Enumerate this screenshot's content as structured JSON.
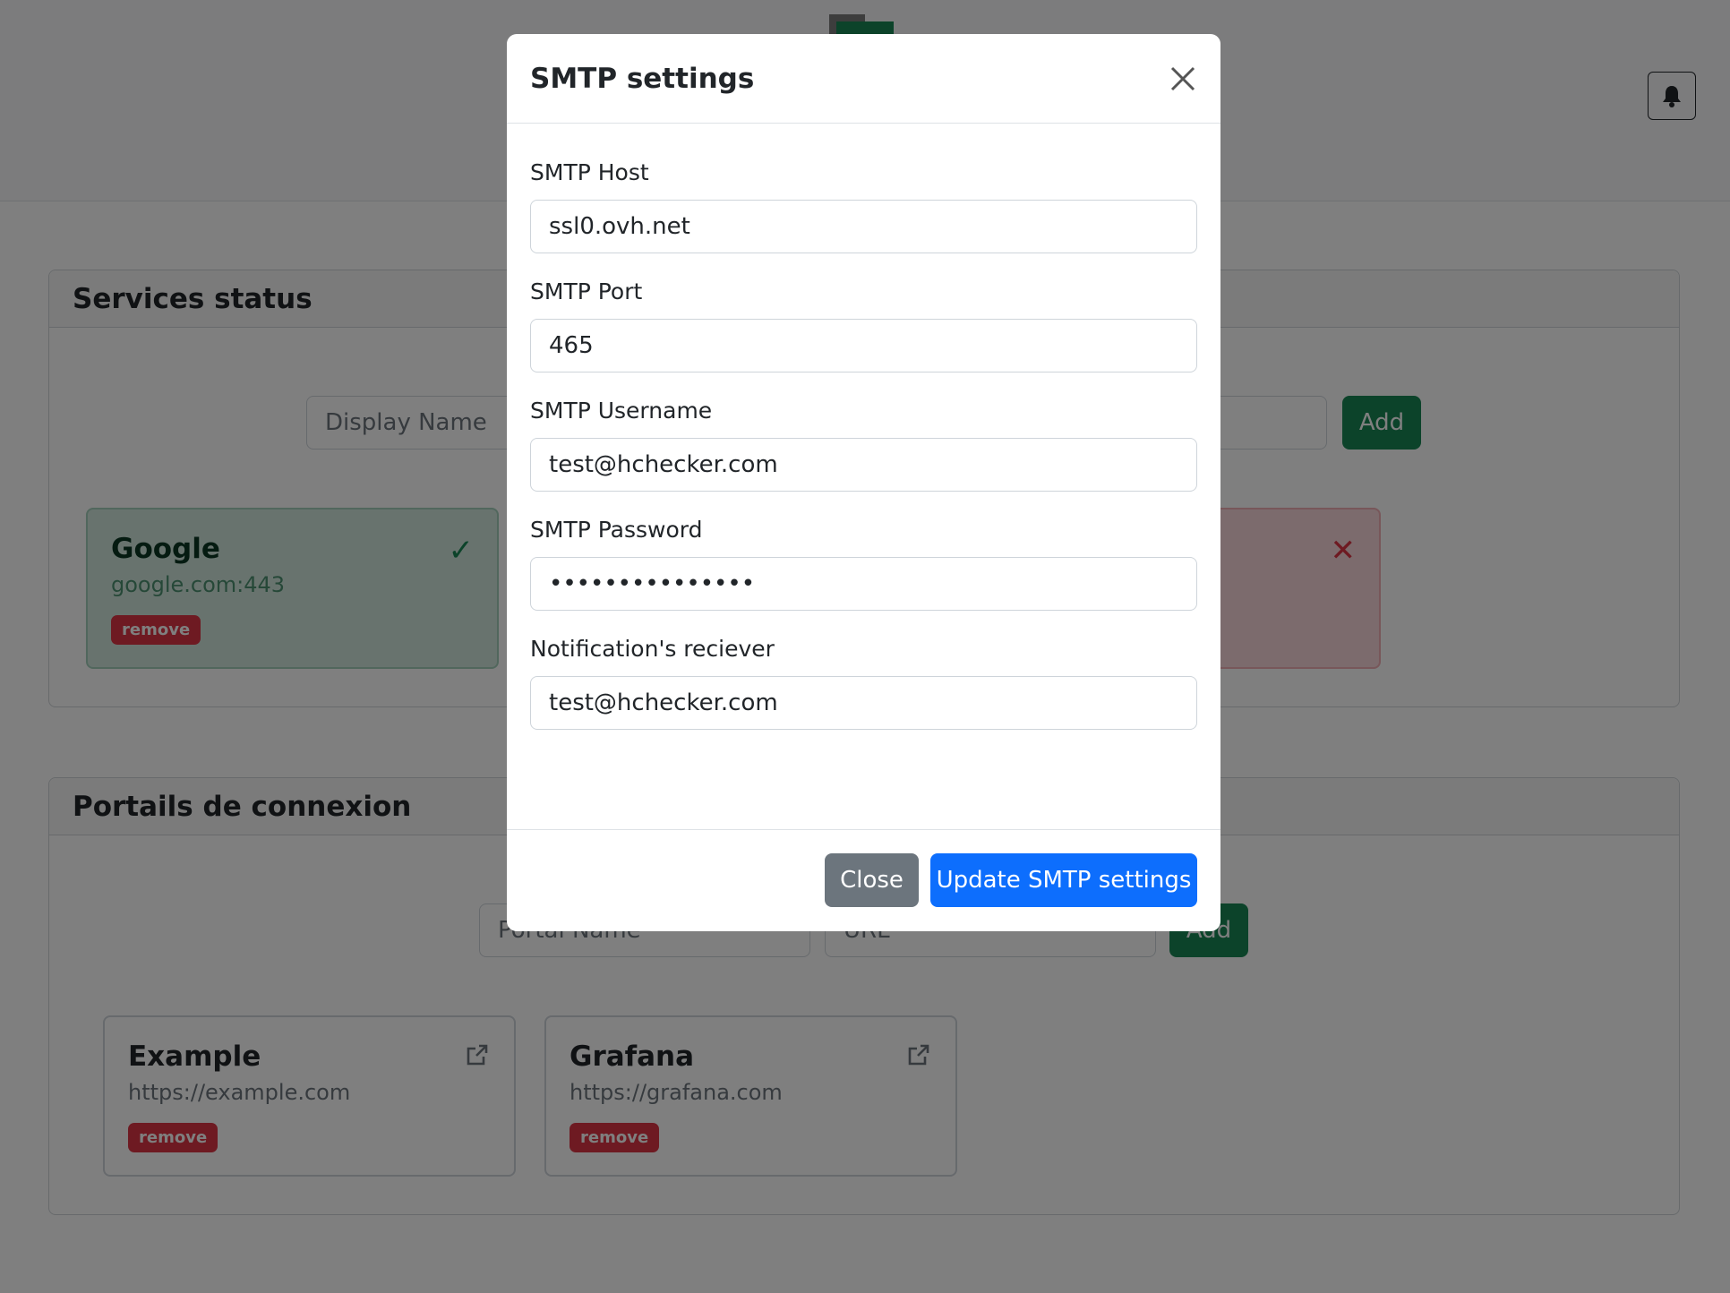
{
  "services": {
    "title": "Services status",
    "display_name_placeholder": "Display Name",
    "add_label": "Add",
    "tiles": [
      {
        "name": "Google",
        "address": "google.com:443",
        "remove_label": "remove",
        "status_icon": "check-icon"
      },
      {
        "status_icon": "cross-icon"
      }
    ]
  },
  "portals": {
    "title": "Portails de connexion",
    "portal_name_placeholder": "Portal Name",
    "url_placeholder": "URL",
    "add_label": "Add",
    "tiles": [
      {
        "name": "Example",
        "url": "https://example.com",
        "remove_label": "remove",
        "icon": "external-link-icon"
      },
      {
        "name": "Grafana",
        "url": "https://grafana.com",
        "remove_label": "remove",
        "icon": "external-link-icon"
      }
    ]
  },
  "modal": {
    "title": "SMTP settings",
    "fields": [
      {
        "label": "SMTP Host",
        "value": "ssl0.ovh.net"
      },
      {
        "label": "SMTP Port",
        "value": "465"
      },
      {
        "label": "SMTP Username",
        "value": "test@hchecker.com"
      },
      {
        "label": "SMTP Password",
        "value": "•••••••••••••••"
      },
      {
        "label": "Notification's reciever",
        "value": "test@hchecker.com"
      }
    ],
    "close_label": "Close",
    "update_label": "Update SMTP settings"
  },
  "colors": {
    "primary": "#0d6efd",
    "success": "#198754",
    "danger": "#dc3545",
    "secondary": "#6c757d"
  }
}
